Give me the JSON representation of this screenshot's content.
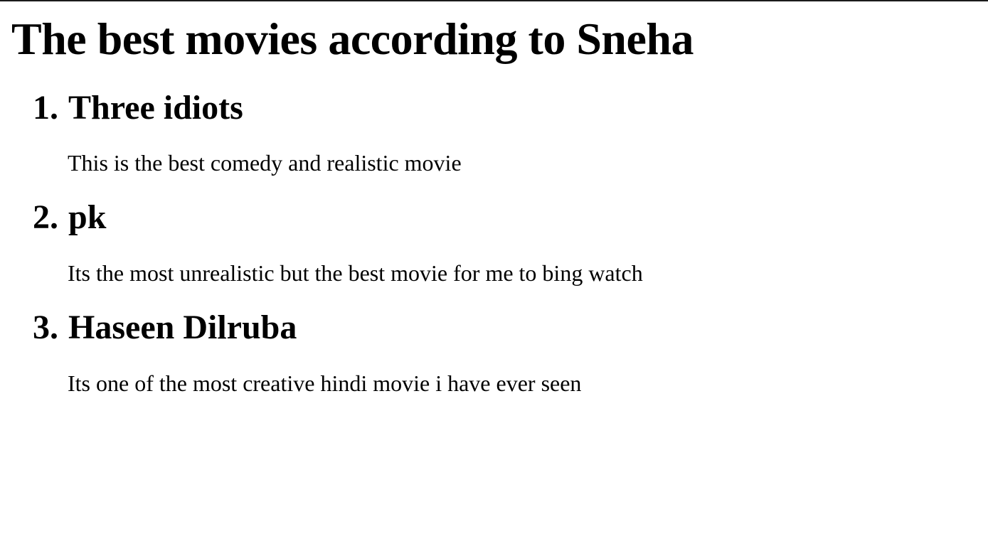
{
  "page": {
    "title": "The best movies according to Sneha"
  },
  "movies": [
    {
      "number": "1.",
      "name": "Three idiots",
      "description": "This is the best comedy and realistic movie"
    },
    {
      "number": "2.",
      "name": "pk",
      "description": "Its the most unrealistic but the best movie for me to bing watch"
    },
    {
      "number": "3.",
      "name": "Haseen Dilruba",
      "description": "Its one of the most creative hindi movie i have ever seen"
    }
  ]
}
